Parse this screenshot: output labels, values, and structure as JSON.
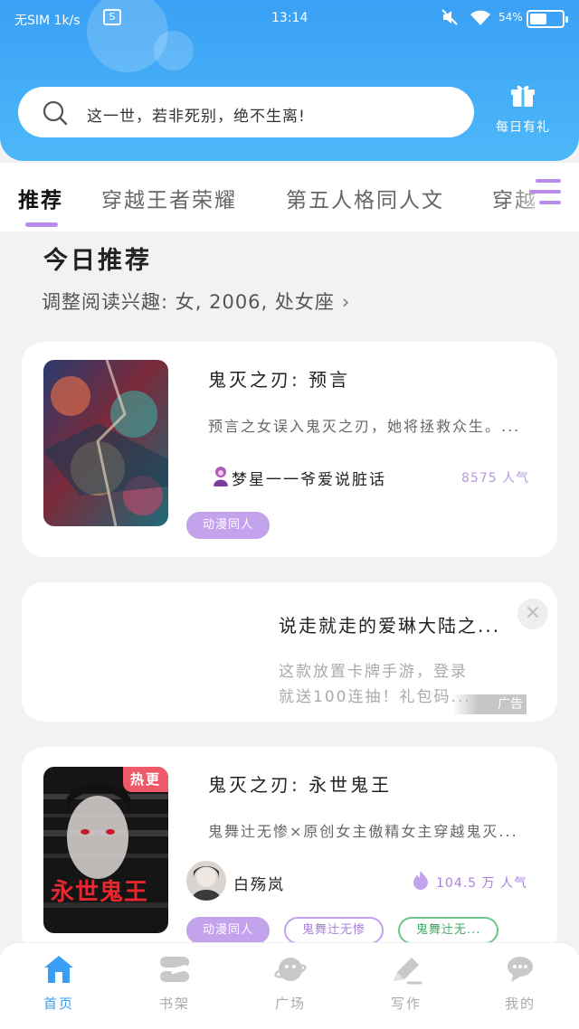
{
  "status_bar": {
    "carrier": "无SIM 1k/s",
    "sim_badge": "S",
    "time": "13:14",
    "battery_percent": "54%",
    "battery_level": 0.54
  },
  "header": {
    "search_placeholder": "这一世，若非死别，绝不生离!",
    "gift_label": "每日有礼"
  },
  "tabs": [
    {
      "label": "推荐",
      "active": true
    },
    {
      "label": "穿越王者荣耀",
      "active": false
    },
    {
      "label": "第五人格同人文",
      "active": false
    },
    {
      "label": "穿越",
      "active": false
    }
  ],
  "section": {
    "title": "今日推荐",
    "interest": "调整阅读兴趣: 女, 2006, 处女座",
    "chevron": "›"
  },
  "books": [
    {
      "title": "鬼灭之刃: 预言",
      "description": "预言之女误入鬼灭之刃，她将拯救众生。...",
      "author": "梦星一一爷爱说脏话",
      "popularity": "8575 人气",
      "tags": [
        "动漫同人"
      ]
    },
    {
      "hot_badge": "热更",
      "title": "鬼灭之刃: 永世鬼王",
      "description": "鬼舞辻无惨×原创女主傲精女主穿越鬼灭...",
      "author": "白殇岚",
      "popularity": "104.5 万 人气",
      "tags": [
        "动漫同人",
        "鬼舞辻无惨",
        "鬼舞辻无..."
      ],
      "cover_text": "永世鬼王"
    }
  ],
  "ad": {
    "title": "说走就走的爱琳大陆之...",
    "line1": "这款放置卡牌手游，登录",
    "line2": "就送100连抽！礼包码...",
    "close": "×",
    "badge": "广告"
  },
  "bottom_nav": [
    {
      "label": "首页",
      "icon": "home-icon",
      "active": true
    },
    {
      "label": "书架",
      "icon": "bookshelf-icon",
      "active": false
    },
    {
      "label": "广场",
      "icon": "planet-icon",
      "active": false
    },
    {
      "label": "写作",
      "icon": "pen-icon",
      "active": false
    },
    {
      "label": "我的",
      "icon": "chat-icon",
      "active": false
    }
  ],
  "colors": {
    "header_blue": "#3aa0f5",
    "accent_purple": "#c2a3ec",
    "hot_red": "#ee5a6a",
    "nav_active": "#3a9ef5"
  }
}
